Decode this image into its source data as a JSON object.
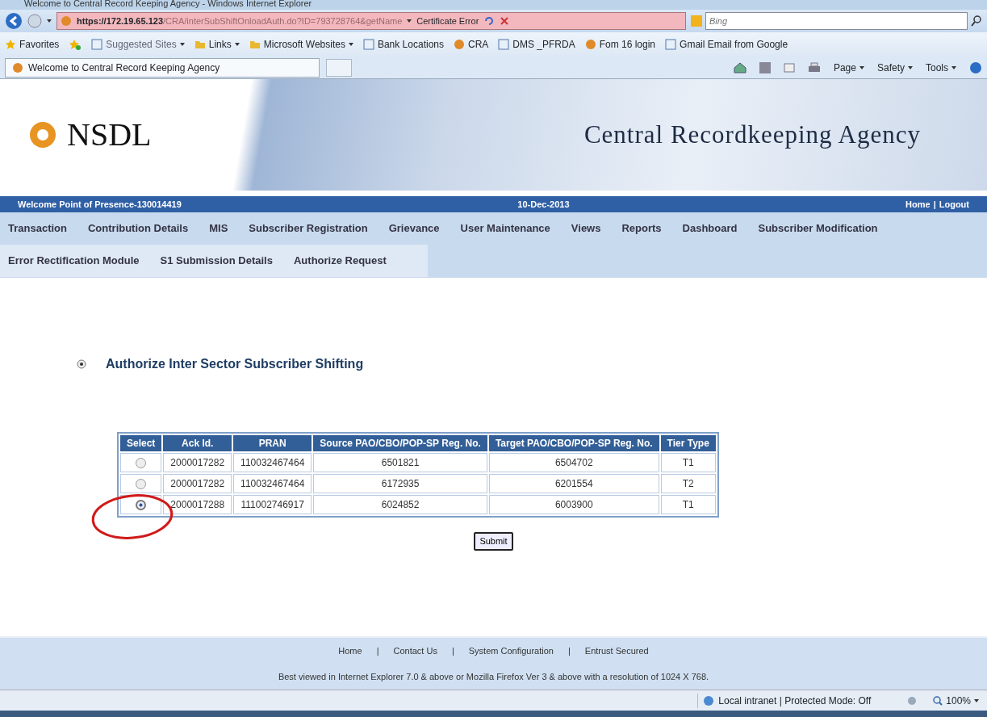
{
  "browser": {
    "title": "Welcome to Central Record Keeping Agency - Windows Internet Explorer",
    "address_host": "https://172.19.65.123",
    "address_path": "/CRA/interSubShiftOnloadAuth.do?ID=793728764&getName",
    "cert_error": "Certificate Error",
    "search_placeholder": "Bing",
    "favorites_label": "Favorites",
    "favorites": [
      {
        "label": "Suggested Sites",
        "kind": "menu"
      },
      {
        "label": "Links",
        "kind": "folder"
      },
      {
        "label": "Microsoft Websites",
        "kind": "folder"
      },
      {
        "label": "Bank Locations",
        "kind": "page"
      },
      {
        "label": "CRA",
        "kind": "site"
      },
      {
        "label": "DMS _PFRDA",
        "kind": "page"
      },
      {
        "label": "Fom 16 login",
        "kind": "site"
      },
      {
        "label": "Gmail Email from Google",
        "kind": "page"
      }
    ],
    "tab_title": "Welcome to Central Record Keeping Agency",
    "commands": [
      "Page",
      "Safety",
      "Tools"
    ]
  },
  "banner": {
    "logo": "NSDL",
    "title": "Central Recordkeeping Agency"
  },
  "info_bar": {
    "welcome": "Welcome Point of Presence-130014419",
    "date": "10-Dec-2013",
    "links": [
      "Home",
      "Logout"
    ],
    "separator": "|"
  },
  "menu_rows": [
    [
      "Transaction",
      "Contribution Details",
      "MIS",
      "Subscriber Registration",
      "Grievance",
      "User Maintenance",
      "Views",
      "Reports",
      "Dashboard",
      "Subscriber Modification"
    ],
    [
      "Error Rectification Module",
      "S1 Submission Details",
      "Authorize Request"
    ]
  ],
  "heading": "Authorize Inter Sector Subscriber Shifting",
  "table": {
    "columns": [
      "Select",
      "Ack Id.",
      "PRAN",
      "Source PAO/CBO/POP-SP Reg. No.",
      "Target PAO/CBO/POP-SP Reg. No.",
      "Tier Type"
    ],
    "rows": [
      {
        "selected": false,
        "cells": [
          "",
          "2000017282",
          "110032467464",
          "6501821",
          "6504702",
          "T1"
        ]
      },
      {
        "selected": false,
        "cells": [
          "",
          "2000017282",
          "110032467464",
          "6172935",
          "6201554",
          "T2"
        ]
      },
      {
        "selected": true,
        "cells": [
          "",
          "2000017288",
          "111002746917",
          "6024852",
          "6003900",
          "T1"
        ]
      }
    ]
  },
  "submit": "Submit",
  "footer": {
    "links": [
      "Home",
      "Contact Us",
      "System Configuration",
      "Entrust Secured"
    ],
    "separator": "|",
    "note": "Best viewed in Internet Explorer 7.0 & above or Mozilla Firefox Ver 3 & above with a resolution of 1024 X 768."
  },
  "status_bar": {
    "zone": "Local intranet | Protected Mode: Off",
    "zoom": "100%"
  }
}
